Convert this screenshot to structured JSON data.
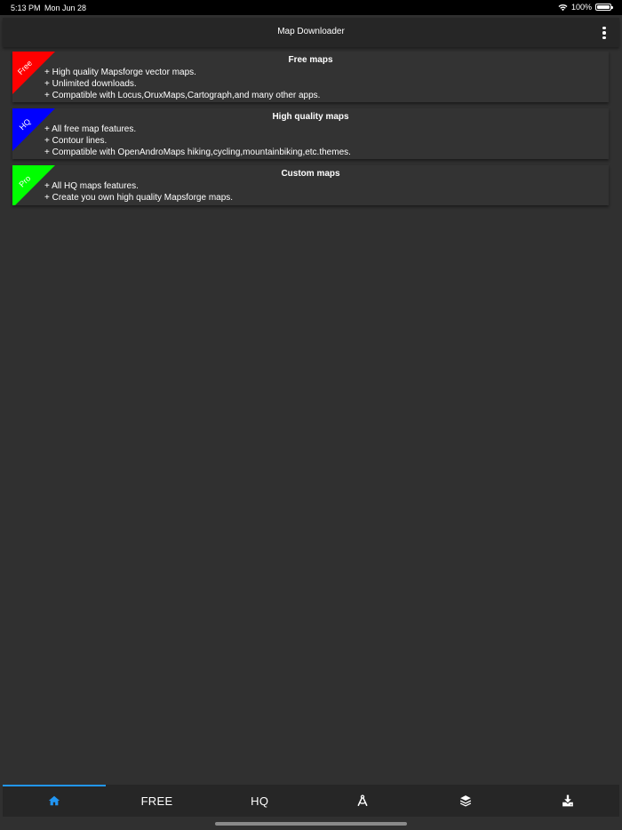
{
  "status_bar": {
    "time": "5:13 PM",
    "date": "Mon Jun 28",
    "battery": "100%"
  },
  "app_bar": {
    "title": "Map Downloader",
    "overflow_icon": "more-vert-icon"
  },
  "cards": [
    {
      "ribbon": "Free",
      "ribbon_color": "#ff0000",
      "title": "Free maps",
      "features": [
        "High quality Mapsforge vector maps.",
        "Unlimited downloads.",
        "Compatible with Locus,OruxMaps,Cartograph,and many other apps."
      ]
    },
    {
      "ribbon": "HQ",
      "ribbon_color": "#0000ff",
      "title": "High quality maps",
      "features": [
        "All free map features.",
        "Contour lines.",
        "Compatible with OpenAndroMaps hiking,cycling,mountainbiking,etc.themes."
      ]
    },
    {
      "ribbon": "Pro",
      "ribbon_color": "#00ff00",
      "title": "Custom maps",
      "features": [
        "All HQ maps features.",
        "Create you own high quality Mapsforge maps."
      ]
    }
  ],
  "bottom_nav": {
    "home_icon": "home-icon",
    "free_label": "FREE",
    "hq_label": "HQ",
    "custom_icon": "drafting-compass-icon",
    "layers_icon": "layers-icon",
    "download_icon": "download-icon",
    "active_index": 0,
    "active_color": "#2196f3"
  },
  "colors": {
    "background": "#303030",
    "bar": "#262626",
    "card": "#333333"
  }
}
